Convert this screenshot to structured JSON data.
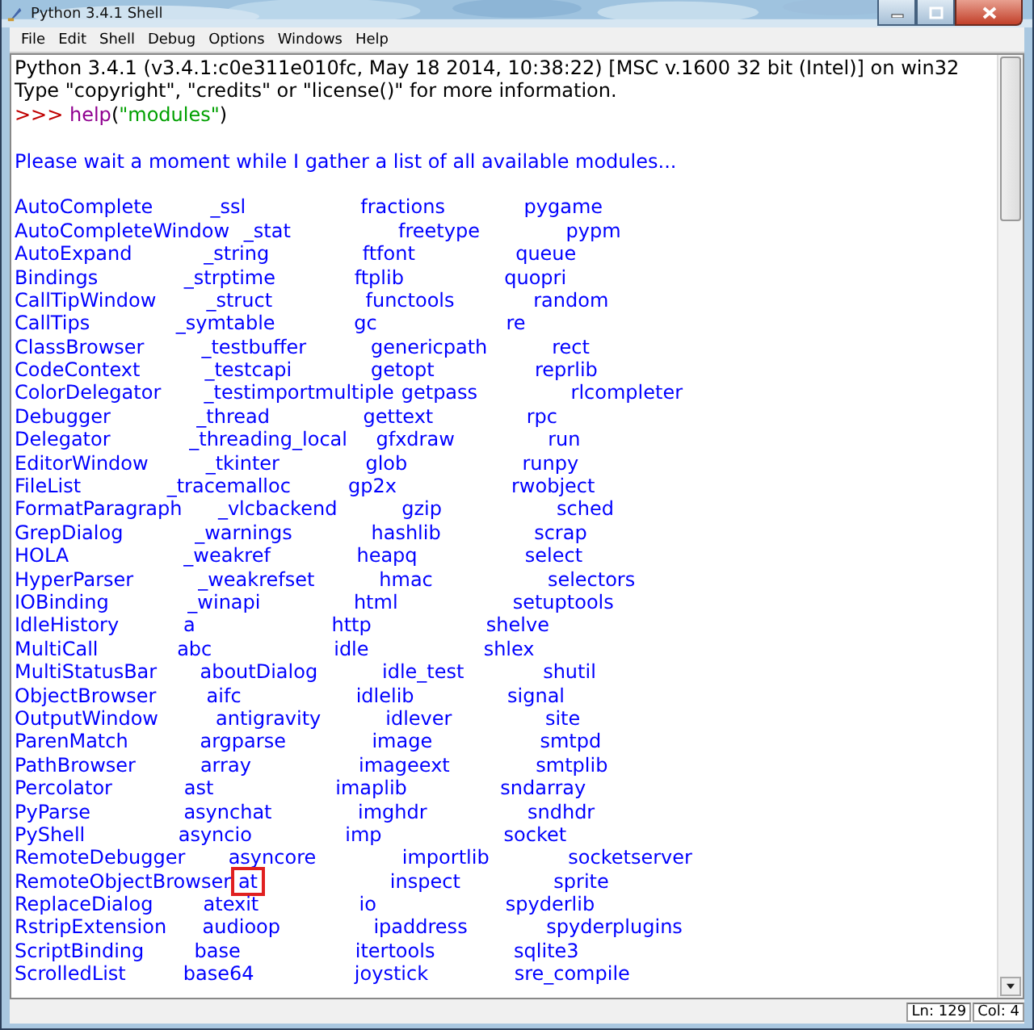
{
  "window": {
    "title": "Python 3.4.1 Shell"
  },
  "menu": [
    "File",
    "Edit",
    "Shell",
    "Debug",
    "Options",
    "Windows",
    "Help"
  ],
  "banner": [
    "Python 3.4.1 (v3.4.1:c0e311e010fc, May 18 2014, 10:38:22) [MSC v.1600 32 bit (Intel)] on win32",
    "Type \"copyright\", \"credits\" or \"license()\" for more information."
  ],
  "prompt_line": [
    {
      "kind": "prompt",
      "text": ">>> "
    },
    {
      "kind": "builtin",
      "text": "help"
    },
    {
      "kind": "plain",
      "text": "("
    },
    {
      "kind": "string",
      "text": "\"modules\""
    },
    {
      "kind": "plain",
      "text": ")"
    }
  ],
  "output_message": "Please wait a moment while I gather a list of all available modules...",
  "module_rows": [
    [
      {
        "text": "AutoComplete",
        "boxed": false
      },
      {
        "text": "_ssl",
        "boxed": false
      },
      {
        "text": "fractions",
        "boxed": false
      },
      {
        "text": "pygame",
        "boxed": false
      }
    ],
    [
      {
        "text": "AutoCompleteWindow",
        "boxed": false
      },
      {
        "text": "_stat",
        "boxed": false
      },
      {
        "text": "freetype",
        "boxed": false
      },
      {
        "text": "pypm",
        "boxed": false
      }
    ],
    [
      {
        "text": "AutoExpand",
        "boxed": false
      },
      {
        "text": "_string",
        "boxed": false
      },
      {
        "text": "ftfont",
        "boxed": false
      },
      {
        "text": "queue",
        "boxed": false
      }
    ],
    [
      {
        "text": "Bindings",
        "boxed": false
      },
      {
        "text": "_strptime",
        "boxed": false
      },
      {
        "text": "ftplib",
        "boxed": false
      },
      {
        "text": "quopri",
        "boxed": false
      }
    ],
    [
      {
        "text": "CallTipWindow",
        "boxed": false
      },
      {
        "text": "_struct",
        "boxed": false
      },
      {
        "text": "functools",
        "boxed": false
      },
      {
        "text": "random",
        "boxed": false
      }
    ],
    [
      {
        "text": "CallTips",
        "boxed": false
      },
      {
        "text": "_symtable",
        "boxed": false
      },
      {
        "text": "gc",
        "boxed": false
      },
      {
        "text": "re",
        "boxed": false
      }
    ],
    [
      {
        "text": "ClassBrowser",
        "boxed": false
      },
      {
        "text": "_testbuffer",
        "boxed": false
      },
      {
        "text": "genericpath",
        "boxed": false
      },
      {
        "text": "rect",
        "boxed": false
      }
    ],
    [
      {
        "text": "CodeContext",
        "boxed": false
      },
      {
        "text": "_testcapi",
        "boxed": false
      },
      {
        "text": "getopt",
        "boxed": false
      },
      {
        "text": "reprlib",
        "boxed": false
      }
    ],
    [
      {
        "text": "ColorDelegator",
        "boxed": false
      },
      {
        "text": "_testimportmultiple",
        "boxed": false
      },
      {
        "text": "getpass",
        "boxed": false
      },
      {
        "text": "rlcompleter",
        "boxed": false
      }
    ],
    [
      {
        "text": "Debugger",
        "boxed": false
      },
      {
        "text": "_thread",
        "boxed": false
      },
      {
        "text": "gettext",
        "boxed": false
      },
      {
        "text": "rpc",
        "boxed": false
      }
    ],
    [
      {
        "text": "Delegator",
        "boxed": false
      },
      {
        "text": "_threading_local",
        "boxed": false
      },
      {
        "text": "gfxdraw",
        "boxed": false
      },
      {
        "text": "run",
        "boxed": false
      }
    ],
    [
      {
        "text": "EditorWindow",
        "boxed": false
      },
      {
        "text": "_tkinter",
        "boxed": false
      },
      {
        "text": "glob",
        "boxed": false
      },
      {
        "text": "runpy",
        "boxed": false
      }
    ],
    [
      {
        "text": "FileList",
        "boxed": false
      },
      {
        "text": "_tracemalloc",
        "boxed": false
      },
      {
        "text": "gp2x",
        "boxed": false
      },
      {
        "text": "rwobject",
        "boxed": false
      }
    ],
    [
      {
        "text": "FormatParagraph",
        "boxed": false
      },
      {
        "text": "_vlcbackend",
        "boxed": false
      },
      {
        "text": "gzip",
        "boxed": false
      },
      {
        "text": "sched",
        "boxed": false
      }
    ],
    [
      {
        "text": "GrepDialog",
        "boxed": false
      },
      {
        "text": "_warnings",
        "boxed": false
      },
      {
        "text": "hashlib",
        "boxed": false
      },
      {
        "text": "scrap",
        "boxed": false
      }
    ],
    [
      {
        "text": "HOLA",
        "boxed": false
      },
      {
        "text": "_weakref",
        "boxed": false
      },
      {
        "text": "heapq",
        "boxed": false
      },
      {
        "text": "select",
        "boxed": false
      }
    ],
    [
      {
        "text": "HyperParser",
        "boxed": false
      },
      {
        "text": "_weakrefset",
        "boxed": false
      },
      {
        "text": "hmac",
        "boxed": false
      },
      {
        "text": "selectors",
        "boxed": false
      }
    ],
    [
      {
        "text": "IOBinding",
        "boxed": false
      },
      {
        "text": "_winapi",
        "boxed": false
      },
      {
        "text": "html",
        "boxed": false
      },
      {
        "text": "setuptools",
        "boxed": false
      }
    ],
    [
      {
        "text": "IdleHistory",
        "boxed": false
      },
      {
        "text": "a",
        "boxed": false
      },
      {
        "text": "http",
        "boxed": false
      },
      {
        "text": "shelve",
        "boxed": false
      }
    ],
    [
      {
        "text": "MultiCall",
        "boxed": false
      },
      {
        "text": "abc",
        "boxed": false
      },
      {
        "text": "idle",
        "boxed": false
      },
      {
        "text": "shlex",
        "boxed": false
      }
    ],
    [
      {
        "text": "MultiStatusBar",
        "boxed": false
      },
      {
        "text": "aboutDialog",
        "boxed": false
      },
      {
        "text": "idle_test",
        "boxed": false
      },
      {
        "text": "shutil",
        "boxed": false
      }
    ],
    [
      {
        "text": "ObjectBrowser",
        "boxed": false
      },
      {
        "text": "aifc",
        "boxed": false
      },
      {
        "text": "idlelib",
        "boxed": false
      },
      {
        "text": "signal",
        "boxed": false
      }
    ],
    [
      {
        "text": "OutputWindow",
        "boxed": false
      },
      {
        "text": "antigravity",
        "boxed": false
      },
      {
        "text": "idlever",
        "boxed": false
      },
      {
        "text": "site",
        "boxed": false
      }
    ],
    [
      {
        "text": "ParenMatch",
        "boxed": false
      },
      {
        "text": "argparse",
        "boxed": false
      },
      {
        "text": "image",
        "boxed": false
      },
      {
        "text": "smtpd",
        "boxed": false
      }
    ],
    [
      {
        "text": "PathBrowser",
        "boxed": false
      },
      {
        "text": "array",
        "boxed": false
      },
      {
        "text": "imageext",
        "boxed": false
      },
      {
        "text": "smtplib",
        "boxed": false
      }
    ],
    [
      {
        "text": "Percolator",
        "boxed": false
      },
      {
        "text": "ast",
        "boxed": false
      },
      {
        "text": "imaplib",
        "boxed": false
      },
      {
        "text": "sndarray",
        "boxed": false
      }
    ],
    [
      {
        "text": "PyParse",
        "boxed": false
      },
      {
        "text": "asynchat",
        "boxed": false
      },
      {
        "text": "imghdr",
        "boxed": false
      },
      {
        "text": "sndhdr",
        "boxed": false
      }
    ],
    [
      {
        "text": "PyShell",
        "boxed": false
      },
      {
        "text": "asyncio",
        "boxed": false
      },
      {
        "text": "imp",
        "boxed": false
      },
      {
        "text": "socket",
        "boxed": false
      }
    ],
    [
      {
        "text": "RemoteDebugger",
        "boxed": false
      },
      {
        "text": "asyncore",
        "boxed": false
      },
      {
        "text": "importlib",
        "boxed": false
      },
      {
        "text": "socketserver",
        "boxed": false
      }
    ],
    [
      {
        "text": "RemoteObjectBrowser",
        "boxed": false
      },
      {
        "text": "at",
        "boxed": true
      },
      {
        "text": "inspect",
        "boxed": false
      },
      {
        "text": "sprite",
        "boxed": false
      }
    ],
    [
      {
        "text": "ReplaceDialog",
        "boxed": false
      },
      {
        "text": "atexit",
        "boxed": false
      },
      {
        "text": "io",
        "boxed": false
      },
      {
        "text": "spyderlib",
        "boxed": false
      }
    ],
    [
      {
        "text": "RstripExtension",
        "boxed": false
      },
      {
        "text": "audioop",
        "boxed": false
      },
      {
        "text": "ipaddress",
        "boxed": false
      },
      {
        "text": "spyderplugins",
        "boxed": false
      }
    ],
    [
      {
        "text": "ScriptBinding",
        "boxed": false
      },
      {
        "text": "base",
        "boxed": false
      },
      {
        "text": "itertools",
        "boxed": false
      },
      {
        "text": "sqlite3",
        "boxed": false
      }
    ],
    [
      {
        "text": "ScrolledList",
        "boxed": false
      },
      {
        "text": "base64",
        "boxed": false
      },
      {
        "text": "joystick",
        "boxed": false
      },
      {
        "text": "sre_compile",
        "boxed": false
      }
    ]
  ],
  "status_bar": {
    "line": "Ln: 129",
    "column": "Col: 4"
  }
}
